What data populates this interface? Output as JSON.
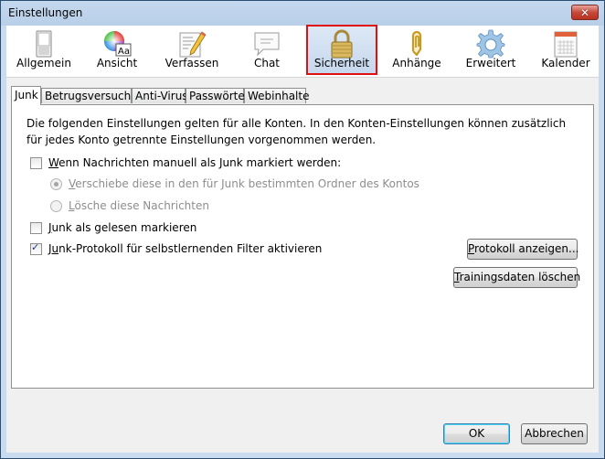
{
  "window": {
    "title": "Einstellungen",
    "close_label": "✕"
  },
  "toolbar": {
    "items": [
      {
        "id": "allgemein",
        "label": "Allgemein",
        "icon": "switch-icon"
      },
      {
        "id": "ansicht",
        "label": "Ansicht",
        "icon": "color-wheel-font-icon"
      },
      {
        "id": "verfassen",
        "label": "Verfassen",
        "icon": "document-pencil-icon"
      },
      {
        "id": "chat",
        "label": "Chat",
        "icon": "speech-bubble-icon"
      },
      {
        "id": "sicherheit",
        "label": "Sicherheit",
        "icon": "padlock-icon",
        "selected": true
      },
      {
        "id": "anhaenge",
        "label": "Anhänge",
        "icon": "paperclip-icon"
      },
      {
        "id": "erweitert",
        "label": "Erweitert",
        "icon": "gear-icon"
      },
      {
        "id": "kalender",
        "label": "Kalender",
        "icon": "calendar-icon"
      }
    ],
    "highlight_color": "#e01010"
  },
  "tabs": [
    {
      "label": "Junk",
      "active": true
    },
    {
      "label": "Betrugsversuche"
    },
    {
      "label": "Anti-Virus"
    },
    {
      "label": "Passwörter"
    },
    {
      "label": "Webinhalte"
    }
  ],
  "junk": {
    "description": "Die folgenden Einstellungen gelten für alle Konten. In den Konten-Einstellungen können zusätzlich für jedes Konto getrennte Einstellungen vorgenommen werden.",
    "manual_mark": {
      "accesskey": "W",
      "rest": "enn Nachrichten manuell als Junk markiert werden:",
      "checked": false
    },
    "move_option": {
      "accesskey": "V",
      "rest": "erschiebe diese in den für Junk bestimmten Ordner des Kontos",
      "selected": true,
      "disabled": true
    },
    "delete_option": {
      "accesskey": "L",
      "rest": "ösche diese Nachrichten",
      "selected": false,
      "disabled": true
    },
    "mark_read": {
      "accesskey": "J",
      "rest": "unk als gelesen markieren",
      "checked": false
    },
    "enable_log": {
      "pre": "J",
      "accesskey": "u",
      "rest": "nk-Protokoll für selbstlernenden Filter aktivieren",
      "checked": true
    },
    "show_log_button": {
      "accesskey": "P",
      "rest": "rotokoll anzeigen..."
    },
    "reset_training_button": {
      "accesskey": "T",
      "rest": "rainingsdaten löschen"
    }
  },
  "footer": {
    "ok_label": "OK",
    "cancel_label": "Abbrechen"
  }
}
